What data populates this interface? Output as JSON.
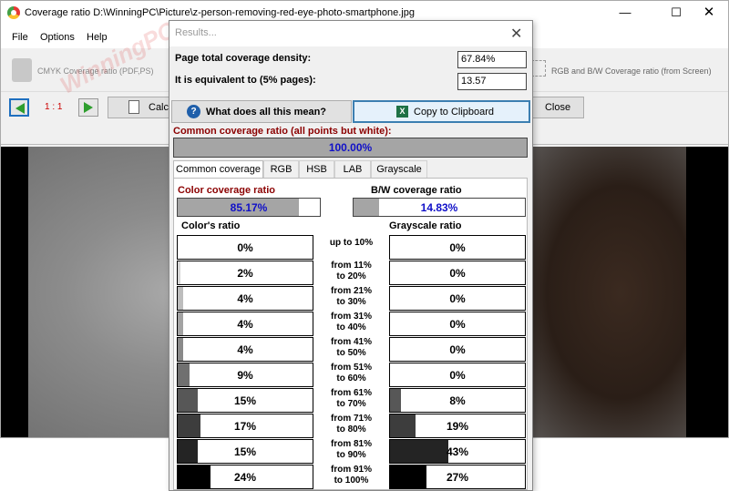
{
  "window": {
    "title": "Coverage ratio  D:\\WinningPC\\Picture\\z-person-removing-red-eye-photo-smartphone.jpg",
    "controls": {
      "minimize": "—",
      "maximize": "☐",
      "close": "✕"
    }
  },
  "menu": {
    "file": "File",
    "options": "Options",
    "help": "Help"
  },
  "toolbar": {
    "cmyk": "CMYK Coverage ratio  (PDF,PS)",
    "rgb": "RGB and B/W Coverage ratio (from Screen)",
    "zoom": "1 : 1",
    "calc": "Calc",
    "close": "Close"
  },
  "watermark": {
    "top": "WinningPC",
    "bottom": "PC"
  },
  "dialog": {
    "title": "Results...",
    "close_glyph": "✕",
    "page_total_label": "Page total coverage density:",
    "page_total_value": "67.84%",
    "equivalent_label": "It is equivalent to (5% pages):",
    "equivalent_value": "13.57",
    "what_button": "What does all this mean?",
    "copy_button": "Copy to Clipboard",
    "common_label": "Common coverage ratio (all points but white):",
    "common_value": "100.00%",
    "common_fraction": 1.0,
    "tabs": [
      "Common coverage",
      "RGB",
      "HSB",
      "LAB",
      "Grayscale"
    ],
    "active_tab": 0,
    "color_ratio_label": "Color coverage ratio",
    "color_ratio_value": "85.17%",
    "color_ratio_fraction": 0.8517,
    "bw_ratio_label": "B/W coverage ratio",
    "bw_ratio_value": "14.83%",
    "bw_ratio_fraction": 0.1483,
    "colors_heading": "Color's ratio",
    "gray_heading": "Grayscale ratio",
    "ranges": [
      {
        "label": "up to 10%",
        "color": "0%",
        "color_level": 0.0,
        "gray": "0%",
        "gray_level": 0.0
      },
      {
        "label": "from 11%\nto 20%",
        "color": "2%",
        "color_level": 0.02,
        "gray": "0%",
        "gray_level": 0.0
      },
      {
        "label": "from 21%\nto 30%",
        "color": "4%",
        "color_level": 0.04,
        "gray": "0%",
        "gray_level": 0.0
      },
      {
        "label": "from 31%\nto 40%",
        "color": "4%",
        "color_level": 0.04,
        "gray": "0%",
        "gray_level": 0.0
      },
      {
        "label": "from 41%\nto 50%",
        "color": "4%",
        "color_level": 0.04,
        "gray": "0%",
        "gray_level": 0.0
      },
      {
        "label": "from 51%\nto 60%",
        "color": "9%",
        "color_level": 0.09,
        "gray": "0%",
        "gray_level": 0.0
      },
      {
        "label": "from 61%\nto 70%",
        "color": "15%",
        "color_level": 0.15,
        "gray": "8%",
        "gray_level": 0.08
      },
      {
        "label": "from 71%\nto 80%",
        "color": "17%",
        "color_level": 0.17,
        "gray": "19%",
        "gray_level": 0.19
      },
      {
        "label": "from 81%\nto 90%",
        "color": "15%",
        "color_level": 0.15,
        "gray": "43%",
        "gray_level": 0.43
      },
      {
        "label": "from 91%\nto 100%",
        "color": "24%",
        "color_level": 0.24,
        "gray": "27%",
        "gray_level": 0.27
      }
    ],
    "shade_colors": [
      "#ffffff",
      "#d6d6d6",
      "#bdbdbd",
      "#a3a3a3",
      "#8a8a8a",
      "#707070",
      "#575757",
      "#3d3d3d",
      "#242424",
      "#000000"
    ]
  }
}
